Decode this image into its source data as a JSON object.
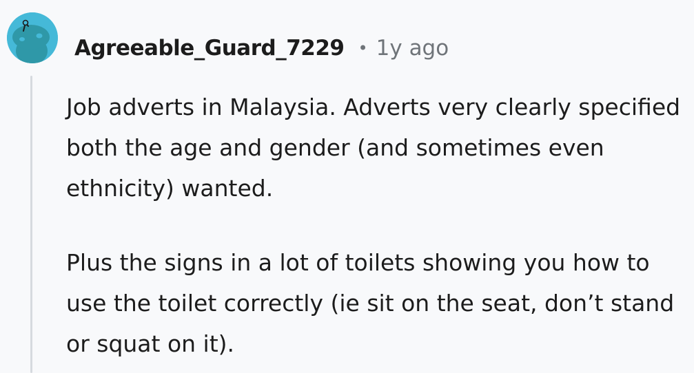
{
  "comment": {
    "author": "Agreeable_Guard_7229",
    "separator": "•",
    "timestamp": "1y ago",
    "avatar_icon": "snoo-avatar-icon",
    "accent_color": "#45b9d8",
    "paragraphs": [
      "Job adverts in Malaysia. Adverts very clearly specified both the age and gender (and sometimes even ethnicity) wanted.",
      "Plus the signs in a lot of toilets showing you how to use the toilet correctly (ie sit on the seat, don’t stand or squat on it)."
    ]
  }
}
